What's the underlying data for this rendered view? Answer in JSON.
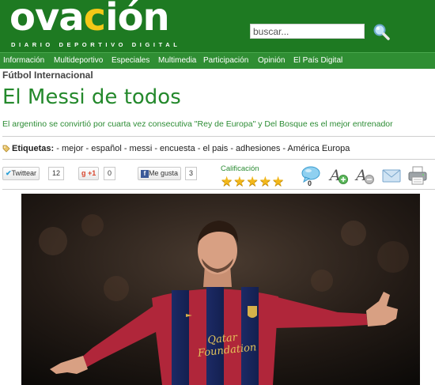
{
  "header": {
    "logo": {
      "pre": "ova",
      "hl": "c",
      "post": "ión",
      "tagline": "DIARIO DEPORTIVO DIGITAL"
    },
    "search": {
      "value": "buscar..."
    }
  },
  "nav": [
    "Información",
    "Multideportivo",
    "Especiales",
    "Multimedia",
    "Participación",
    "Opinión",
    "El País Digital"
  ],
  "article": {
    "section": "Fútbol Internacional",
    "title": "El Messi de todos",
    "subtitle": "El argentino se convirtió por cuarta vez consecutiva \"Rey de Europa\" y Del Bosque es el mejor entrenador",
    "tags_label": "Etiquetas:",
    "tags": "- mejor - español - messi - encuesta - el pais - adhesiones - América Europa"
  },
  "share": {
    "twitter": {
      "label": "Twittear",
      "count": "12"
    },
    "gplus": {
      "label": "+1",
      "count": "0"
    },
    "facebook": {
      "label": "Me gusta",
      "count": "3"
    },
    "rating": {
      "label": "Calificación",
      "stars": 5
    },
    "comments": "0"
  },
  "photo": {
    "jersey_text": "Qatar Foundation"
  },
  "colors": {
    "brand_green": "#1e7a22",
    "nav_green": "#2f8e33",
    "title_green": "#24892c",
    "accent_yellow": "#f4c817"
  }
}
